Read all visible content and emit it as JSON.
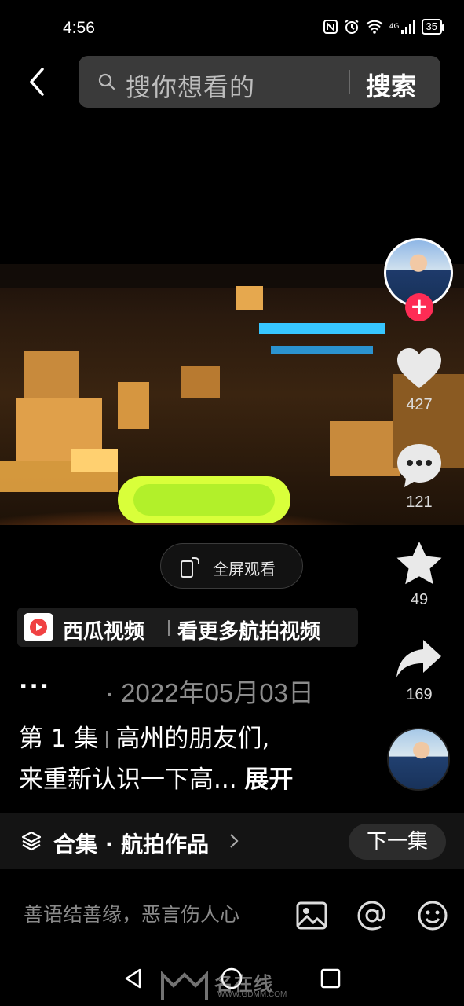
{
  "status_bar": {
    "time": "4:56",
    "network": "4G",
    "battery": "35"
  },
  "search": {
    "placeholder": "搜你想看的",
    "submit_label": "搜索"
  },
  "video": {
    "fullscreen_label": "全屏观看"
  },
  "actions": {
    "likes": "427",
    "comments": "121",
    "favorites": "49",
    "shares": "169"
  },
  "promo": {
    "brand": "西瓜视频",
    "text": "看更多航拍视频"
  },
  "post": {
    "ellipsis": "...",
    "date": "· 2022年05月03日",
    "episode": "第 1 集",
    "description_line1": "高州的朋友们,",
    "description_line2": "来重新认识一下高...",
    "expand_label": "展开"
  },
  "collection": {
    "label": "合集 · 航拍作品",
    "next_label": "下一集"
  },
  "comment": {
    "placeholder": "善语结善缘，恶言伤人心"
  },
  "watermark": {
    "text": "名在线",
    "url": "WWW.GDMM.COM"
  },
  "colors": {
    "background": "#000000",
    "follow": "#fe2c55",
    "panel": "#141414"
  },
  "icons": [
    "back-icon",
    "search-icon",
    "heart-icon",
    "comment-icon",
    "star-icon",
    "share-icon",
    "fullscreen-icon",
    "layers-icon",
    "image-icon",
    "at-icon",
    "emoji-icon"
  ]
}
